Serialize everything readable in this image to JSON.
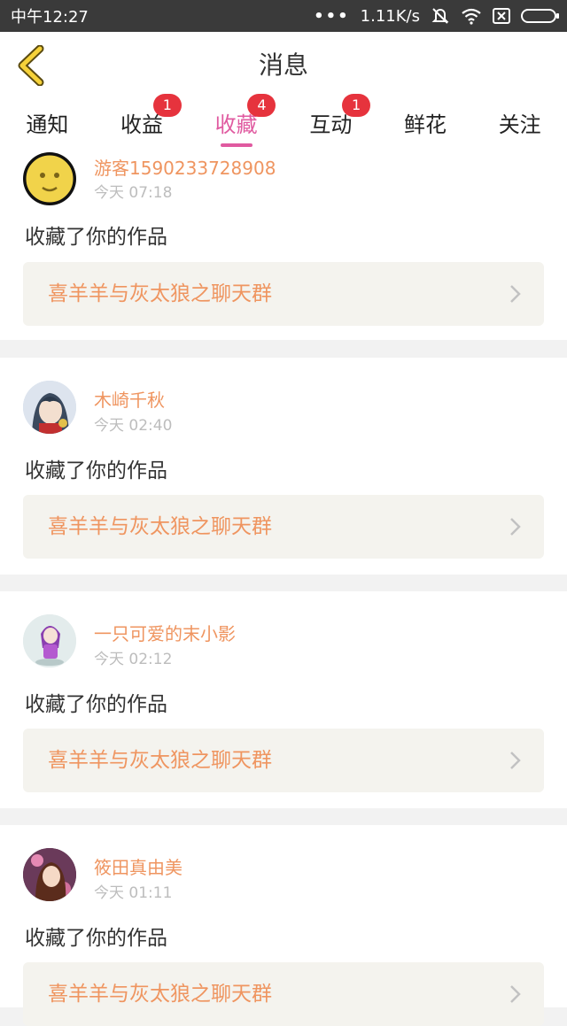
{
  "status_bar": {
    "time": "中午12:27",
    "net_speed": "1.11K/s"
  },
  "header": {
    "title": "消息",
    "back_icon": "chevron-left-icon"
  },
  "tabs": [
    {
      "label": "通知",
      "badge": ""
    },
    {
      "label": "收益",
      "badge": "1"
    },
    {
      "label": "收藏",
      "badge": "4",
      "active": true
    },
    {
      "label": "互动",
      "badge": "1"
    },
    {
      "label": "鲜花",
      "badge": ""
    },
    {
      "label": "关注",
      "badge": ""
    }
  ],
  "items": [
    {
      "user": "游客1590233728908",
      "time": "今天 07:18",
      "action": "收藏了你的作品",
      "work": "喜羊羊与灰太狼之聊天群"
    },
    {
      "user": "木崎千秋",
      "time": "今天 02:40",
      "action": "收藏了你的作品",
      "work": "喜羊羊与灰太狼之聊天群"
    },
    {
      "user": "一只可爱的末小影",
      "time": "今天 02:12",
      "action": "收藏了你的作品",
      "work": "喜羊羊与灰太狼之聊天群"
    },
    {
      "user": "筱田真由美",
      "time": "今天 01:11",
      "action": "收藏了你的作品",
      "work": "喜羊羊与灰太狼之聊天群"
    }
  ],
  "colors": {
    "accent_pink": "#e05aa0",
    "badge_red": "#e6333d",
    "name_orange": "#ef9560",
    "header_yellow": "#f6d23a"
  }
}
